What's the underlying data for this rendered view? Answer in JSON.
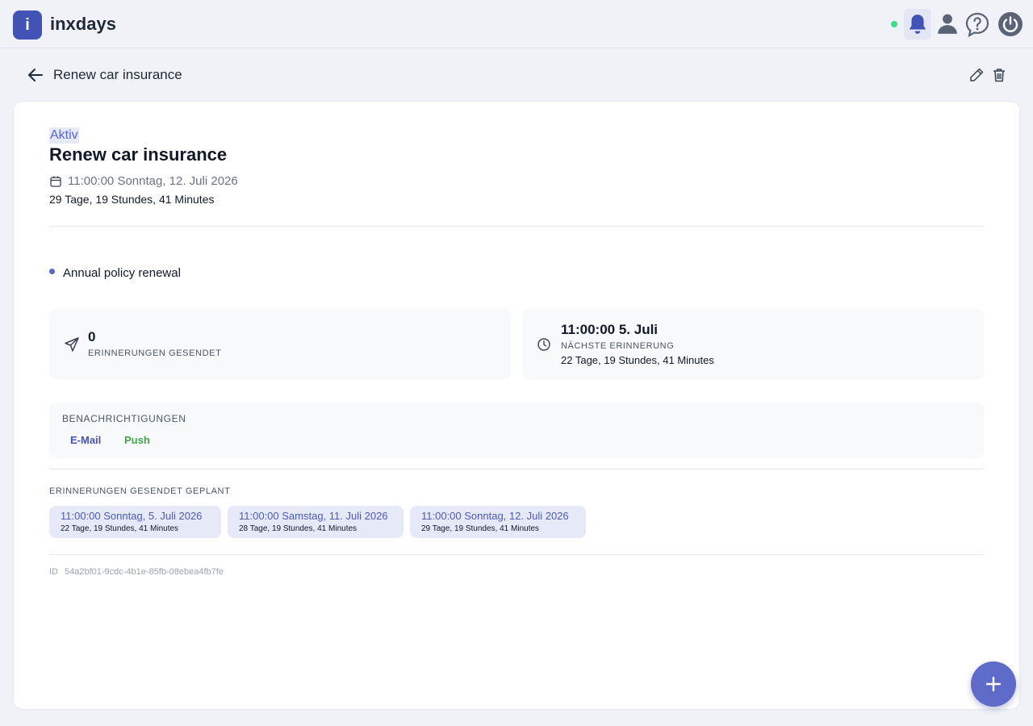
{
  "app": {
    "logo_letter": "i",
    "name": "inxdays",
    "accent": "#4353b5",
    "online_color": "#3ddc84"
  },
  "header_icons": [
    "bell-icon",
    "user-icon",
    "help-icon",
    "power-icon"
  ],
  "subheader": {
    "title": "Renew car insurance",
    "back_icon": "arrow-left-icon",
    "actions": [
      "edit-icon",
      "trash-icon"
    ]
  },
  "task": {
    "status": "Aktiv",
    "title": "Renew car insurance",
    "due_datetime": "11:00:00 Sonntag, 12. Juli 2026",
    "countdown": "29 Tage, 19 Stundes, 41 Minutes",
    "note": "Annual policy renewal"
  },
  "stats": {
    "sent_count": "0",
    "sent_label": "ERINNERUNGEN GESENDET",
    "next_time": "11:00:00 5. Juli",
    "next_label": "NÄCHSTE ERINNERUNG",
    "next_countdown": "22 Tage, 19 Stundes, 41 Minutes"
  },
  "notifications": {
    "title": "BENACHRICHTIGUNGEN",
    "channels": [
      {
        "label": "E-Mail",
        "color": "#4353b5"
      },
      {
        "label": "Push",
        "color": "#3fa54a"
      }
    ]
  },
  "scheduled": {
    "title": "ERINNERUNGEN GESENDET GEPLANT",
    "items": [
      {
        "date": "11:00:00 Sonntag, 5. Juli 2026",
        "countdown": "22 Tage, 19 Stundes, 41 Minutes"
      },
      {
        "date": "11:00:00 Samstag, 11. Juli 2026",
        "countdown": "28 Tage, 19 Stundes, 41 Minutes"
      },
      {
        "date": "11:00:00 Sonntag, 12. Juli 2026",
        "countdown": "29 Tage, 19 Stundes, 41 Minutes"
      }
    ]
  },
  "meta": {
    "id_label": "ID",
    "id_value": "54a2bf01-9cdc-4b1e-85fb-08ebea4fb7fe"
  },
  "fab_icon": "plus-icon"
}
